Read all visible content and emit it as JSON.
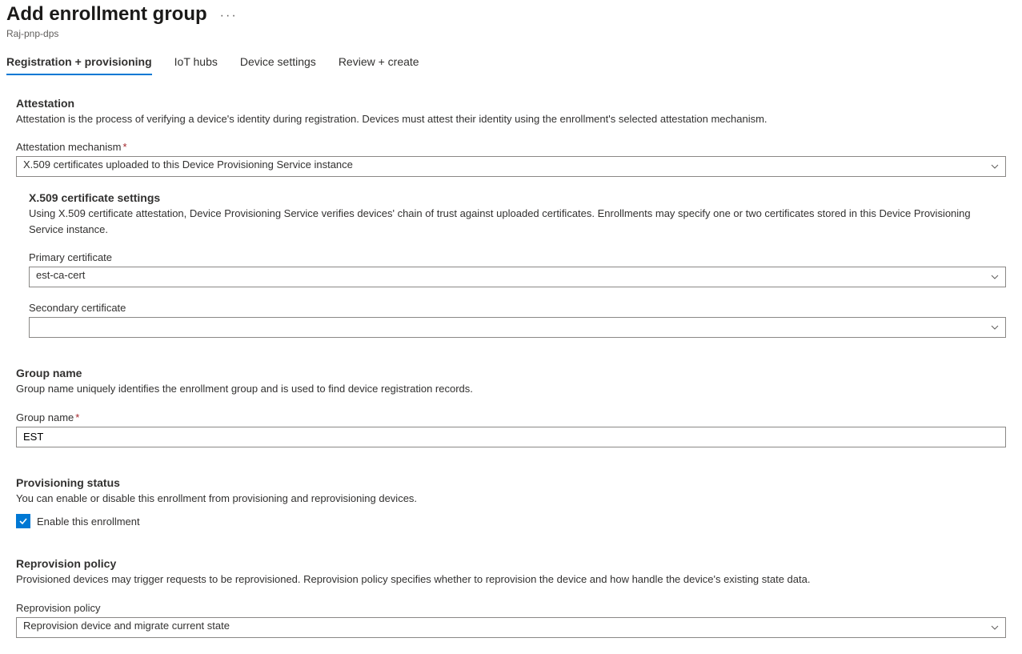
{
  "header": {
    "title": "Add enrollment group",
    "subtitle": "Raj-pnp-dps",
    "more_label": "···"
  },
  "tabs": [
    {
      "label": "Registration + provisioning",
      "active": true
    },
    {
      "label": "IoT hubs",
      "active": false
    },
    {
      "label": "Device settings",
      "active": false
    },
    {
      "label": "Review + create",
      "active": false
    }
  ],
  "attestation": {
    "title": "Attestation",
    "desc": "Attestation is the process of verifying a device's identity during registration. Devices must attest their identity using the enrollment's selected attestation mechanism.",
    "mechanism_label": "Attestation mechanism",
    "mechanism_value": "X.509 certificates uploaded to this Device Provisioning Service instance"
  },
  "x509": {
    "title": "X.509 certificate settings",
    "desc": "Using X.509 certificate attestation, Device Provisioning Service verifies devices' chain of trust against uploaded certificates. Enrollments may specify one or two certificates stored in this Device Provisioning Service instance.",
    "primary_label": "Primary certificate",
    "primary_value": "est-ca-cert",
    "secondary_label": "Secondary certificate",
    "secondary_value": ""
  },
  "group": {
    "title": "Group name",
    "desc": "Group name uniquely identifies the enrollment group and is used to find device registration records.",
    "name_label": "Group name",
    "name_value": "EST"
  },
  "provisioning": {
    "title": "Provisioning status",
    "desc": "You can enable or disable this enrollment from provisioning and reprovisioning devices.",
    "enable_label": "Enable this enrollment",
    "enable_checked": true
  },
  "reprovision": {
    "title": "Reprovision policy",
    "desc": "Provisioned devices may trigger requests to be reprovisioned. Reprovision policy specifies whether to reprovision the device and how handle the device's existing state data.",
    "policy_label": "Reprovision policy",
    "policy_value": "Reprovision device and migrate current state"
  }
}
